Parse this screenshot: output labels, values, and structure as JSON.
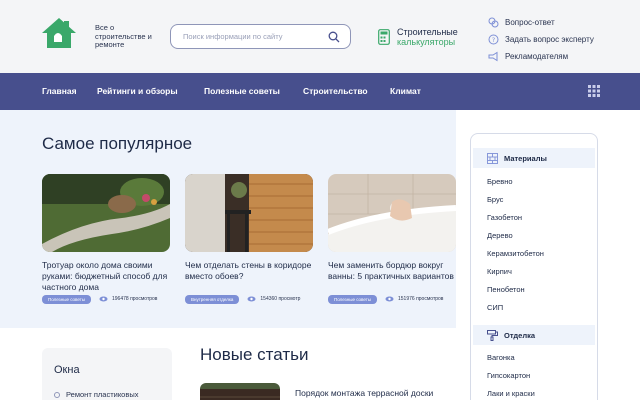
{
  "header": {
    "tagline": "Все о строительстве и ремонте",
    "search_placeholder": "Поиск информации по сайту",
    "calc_line1": "Строительные",
    "calc_line2": "калькуляторы",
    "links": [
      {
        "label": "Вопрос-ответ",
        "icon": "chat-icon"
      },
      {
        "label": "Задать вопрос эксперту",
        "icon": "question-icon"
      },
      {
        "label": "Рекламодателям",
        "icon": "megaphone-icon"
      }
    ]
  },
  "nav": {
    "items": [
      "Главная",
      "Рейтинги и обзоры",
      "Полезные советы",
      "Строительство",
      "Климат"
    ]
  },
  "popular": {
    "title": "Самое популярное",
    "cards": [
      {
        "title": "Тротуар около дома своими руками: бюджетный способ для частного дома",
        "badge": "Полезные советы",
        "views": "196478 просмотров"
      },
      {
        "title": "Чем отделать стены в коридоре вместо обоев?",
        "badge": "Внутренняя отделка",
        "views": "154360 просмотр"
      },
      {
        "title": "Чем заменить бордюр вокруг ванны: 5 практичных вариантов",
        "badge": "Полезные советы",
        "views": "151976 просмотров"
      }
    ]
  },
  "sidebar": {
    "materials_title": "Материалы",
    "materials": [
      "Бревно",
      "Брус",
      "Газобетон",
      "Дерево",
      "Керамзитобетон",
      "Кирпич",
      "Пенобетон",
      "СИП"
    ],
    "finishing_title": "Отделка",
    "finishing": [
      "Вагонка",
      "Гипсокартон",
      "Лаки и краски"
    ]
  },
  "windows": {
    "title": "Окна",
    "item": "Ремонт пластиковых"
  },
  "new_articles": {
    "title": "Новые статьи",
    "first": "Порядок монтажа террасной доски"
  },
  "colors": {
    "nav_bg": "#474f8d",
    "accent_green": "#3aa86a",
    "badge": "#7d8fd6"
  }
}
